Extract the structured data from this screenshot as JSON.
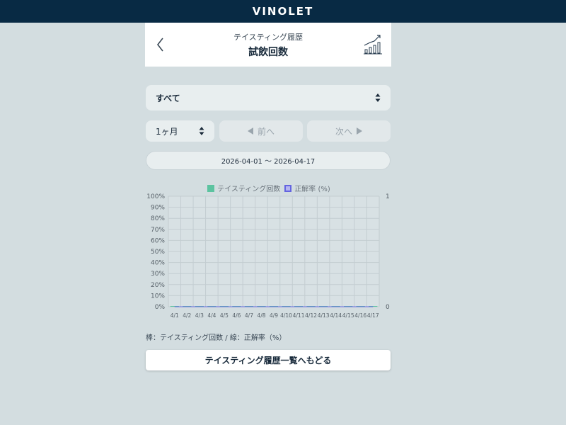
{
  "app": {
    "title": "VINOLET"
  },
  "header": {
    "subtitle": "テイスティング履歴",
    "title": "試飲回数",
    "back_icon": "chevron-left-icon",
    "chart_icon": "bar-chart-trend-icon"
  },
  "filters": {
    "category": {
      "selected": "すべて"
    },
    "period": {
      "selected": "1ヶ月"
    },
    "prev_label": "前へ",
    "next_label": "次へ"
  },
  "date_range": "2026-04-01 〜 2026-04-17",
  "colors": {
    "bar": "#5cc3a0",
    "line": "#6464e0",
    "header_bg": "#082a44"
  },
  "chart_data": {
    "type": "bar",
    "categories": [
      "4/1",
      "4/2",
      "4/3",
      "4/4",
      "4/5",
      "4/6",
      "4/7",
      "4/8",
      "4/9",
      "4/10",
      "4/11",
      "4/12",
      "4/13",
      "4/14",
      "4/15",
      "4/16",
      "4/17"
    ],
    "series": [
      {
        "name": "テイスティング回数",
        "type": "bar",
        "axis": "right",
        "values": [
          0,
          0,
          0,
          0,
          0,
          0,
          0,
          0,
          0,
          0,
          0,
          0,
          0,
          0,
          0,
          0,
          0
        ]
      },
      {
        "name": "正解率 (%)",
        "type": "line",
        "axis": "left",
        "values": [
          0,
          0,
          0,
          0,
          0,
          0,
          0,
          0,
          0,
          0,
          0,
          0,
          0,
          0,
          0,
          0,
          0
        ]
      }
    ],
    "left_axis": {
      "ticks": [
        "0%",
        "10%",
        "20%",
        "30%",
        "40%",
        "50%",
        "60%",
        "70%",
        "80%",
        "90%",
        "100%"
      ],
      "range": [
        0,
        100
      ]
    },
    "right_axis": {
      "ticks": [
        "0",
        "1"
      ],
      "range": [
        0,
        1
      ]
    },
    "grid": true,
    "legend_position": "top"
  },
  "note": "棒：テイスティング回数 / 線：正解率（%）",
  "footer": {
    "back_to_list_label": "テイスティング履歴一覧へもどる"
  }
}
